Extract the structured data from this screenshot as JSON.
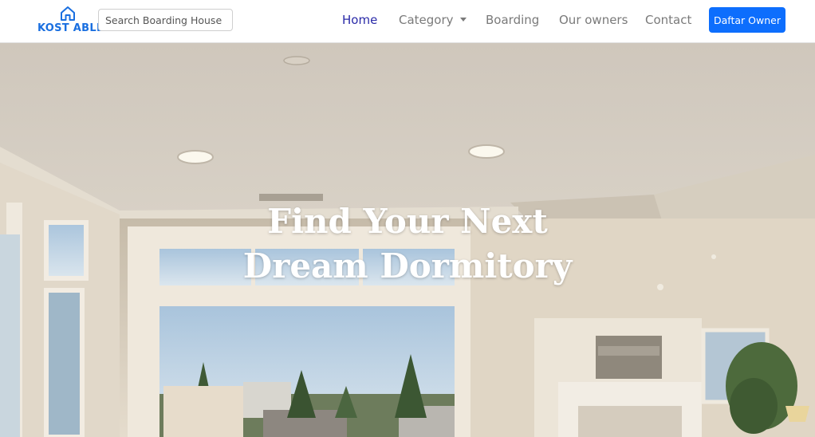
{
  "brand": {
    "name": "KOST ABLE",
    "icon": "house-icon",
    "color": "#1a6fe0"
  },
  "search": {
    "placeholder": "Search Boarding House",
    "value": ""
  },
  "nav": {
    "home": "Home",
    "category": "Category",
    "boarding": "Boarding",
    "owners": "Our owners",
    "contact": "Contact",
    "active": "Home"
  },
  "cta": {
    "label": "Daftar Owner",
    "color": "#0d6efd"
  },
  "hero": {
    "line1": "Find Your Next",
    "line2": "Dream Dormitory",
    "background": "interior living room with large windows"
  }
}
